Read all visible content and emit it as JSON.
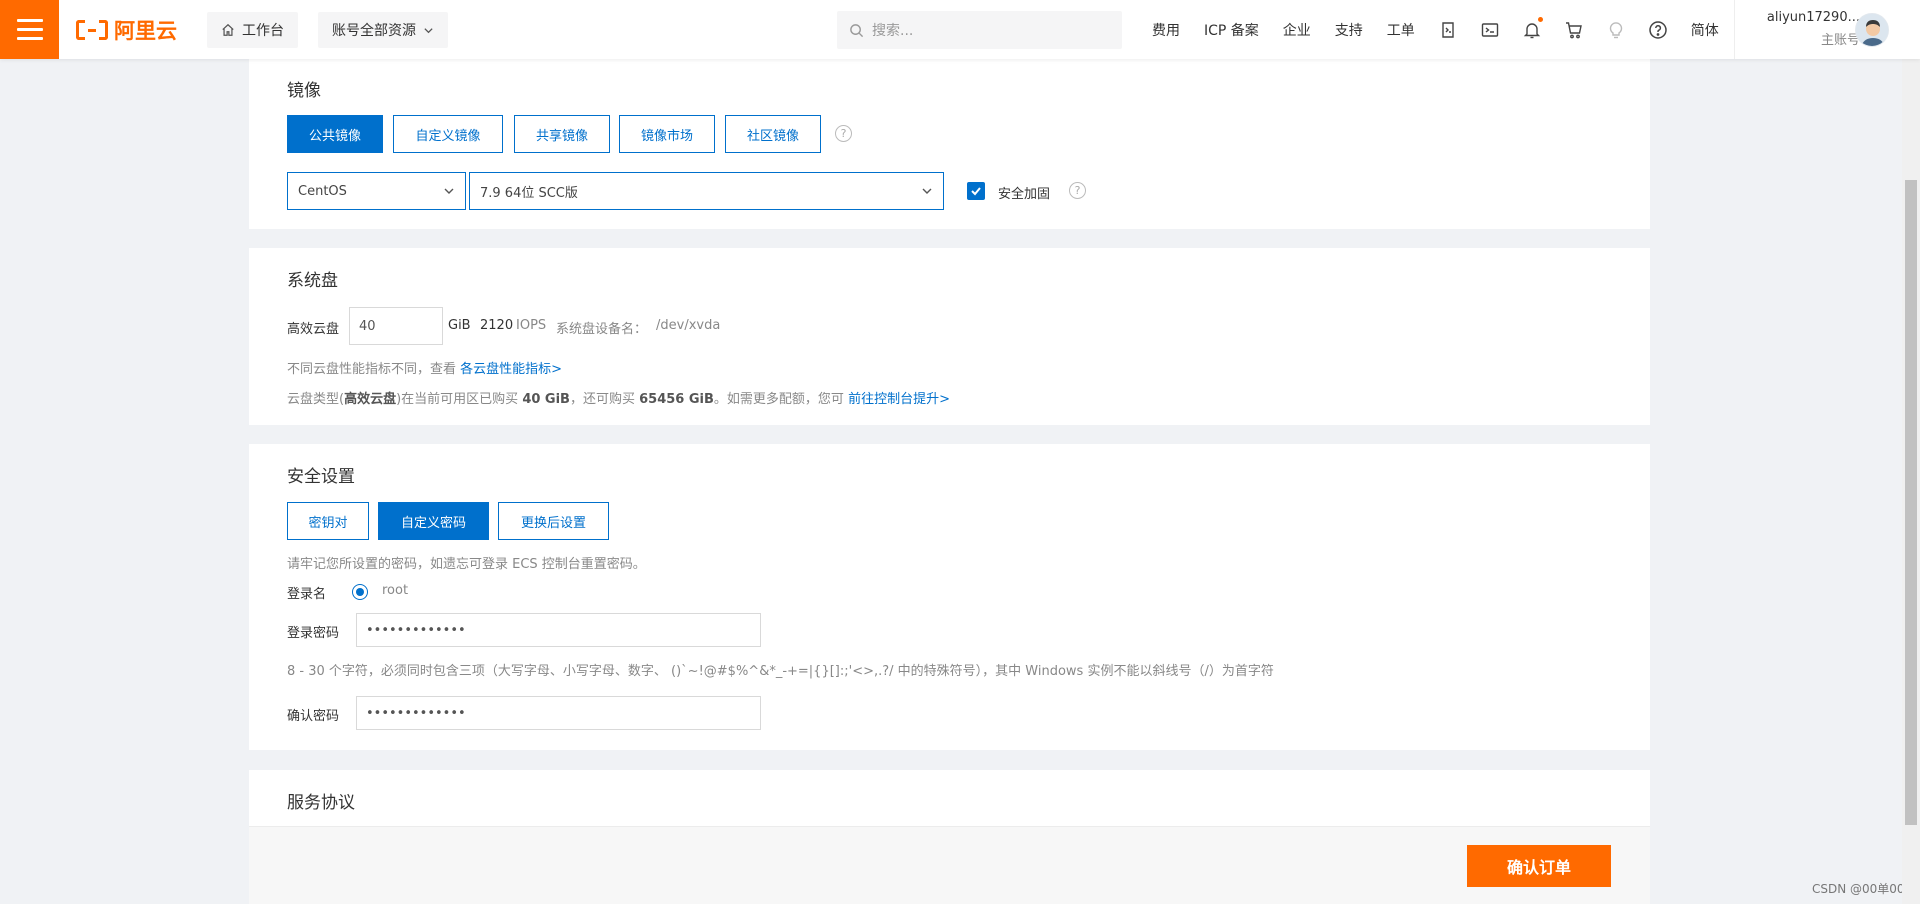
{
  "nav": {
    "brand": "阿里云",
    "workbench": "工作台",
    "resources": "账号全部资源",
    "search_placeholder": "搜索...",
    "links": [
      "费用",
      "ICP 备案",
      "企业",
      "支持",
      "工单"
    ],
    "lang": "简体",
    "username": "aliyun17290...",
    "user_role": "主账号"
  },
  "image_section": {
    "title": "镜像",
    "tabs": [
      "公共镜像",
      "自定义镜像",
      "共享镜像",
      "镜像市场",
      "社区镜像"
    ],
    "active_tab": "公共镜像",
    "os": "CentOS",
    "version": "7.9 64位 SCC版",
    "security_label": "安全加固",
    "security_checked": true
  },
  "disk_section": {
    "title": "系统盘",
    "disk_type": "高效云盘",
    "size": "40",
    "unit": "GiB",
    "iops_value": "2120",
    "iops_label": "IOPS",
    "device_label": "系统盘设备名：",
    "device": "/dev/xvda",
    "perf_hint": "不同云盘性能指标不同，查看",
    "perf_link": "各云盘性能指标>",
    "quota_prefix": "云盘类型(",
    "quota_type": "高效云盘",
    "quota_mid1": ")在当前可用区已购买",
    "quota_bought": "40 GiB",
    "quota_mid2": "，还可购买",
    "quota_remaining": "65456 GiB",
    "quota_mid3": "。如需更多配额，您可",
    "quota_link": "前往控制台提升>"
  },
  "security_section": {
    "title": "安全设置",
    "tabs": [
      "密钥对",
      "自定义密码",
      "更换后设置"
    ],
    "active_tab": "自定义密码",
    "reminder": "请牢记您所设置的密码，如遗忘可登录 ECS 控制台重置密码。",
    "login_name_label": "登录名",
    "login_name": "root",
    "password_label": "登录密码",
    "password_value": "•••••••••••••",
    "password_rule": "8 - 30 个字符，必须同时包含三项（大写字母、小写字母、数字、 ()`~!@#$%^&*_-+=|{}[]:;'<>,.?/ 中的特殊符号），其中 Windows 实例不能以斜线号（/）为首字符",
    "confirm_label": "确认密码",
    "confirm_value": "•••••••••••••"
  },
  "service_section": {
    "title": "服务协议"
  },
  "footer": {
    "confirm_button": "确认订单",
    "watermark": "CSDN @00单00"
  },
  "colors": {
    "brand_orange": "#ff6a00",
    "primary_blue": "#0070cc",
    "page_bg": "#f0f2f5"
  }
}
